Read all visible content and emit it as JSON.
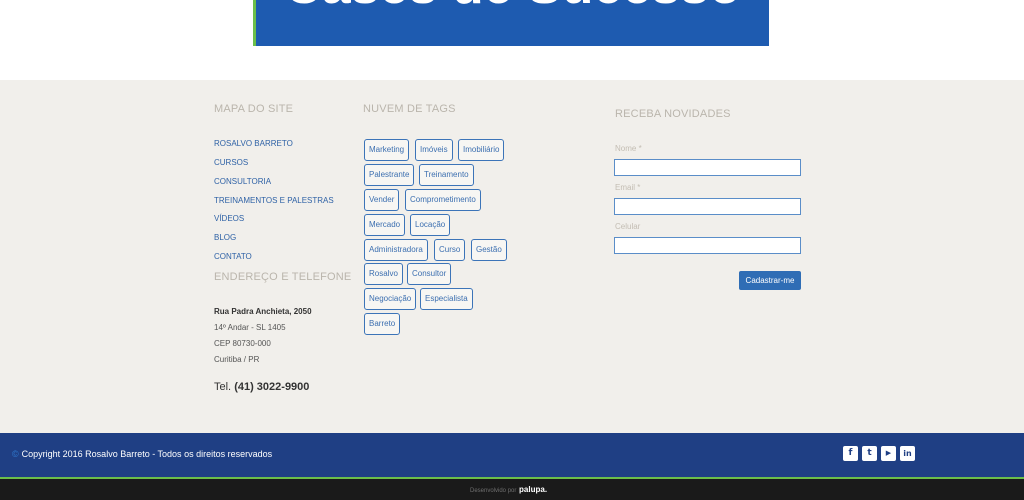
{
  "hero": {
    "text": "Cases de Sucesso"
  },
  "sitemap": {
    "heading": "MAPA DO SITE",
    "links": [
      "ROSALVO BARRETO",
      "CURSOS",
      "CONSULTORIA",
      "TREINAMENTOS E PALESTRAS",
      "VÍDEOS",
      "BLOG",
      "CONTATO"
    ]
  },
  "address": {
    "heading": "ENDEREÇO E TELEFONE",
    "street": "Rua Padra Anchieta, 2050",
    "floor": "14º Andar - SL 1405",
    "cep": "CEP 80730-000",
    "city": "Curitiba / PR",
    "phone_label": "Tel.",
    "phone_number": "(41) 3022-9900"
  },
  "tags": {
    "heading": "NUVEM DE TAGS",
    "items": [
      "Marketing",
      "Imóveis",
      "Imobiliário",
      "Palestrante",
      "Treinamento",
      "Vender",
      "Comprometimento",
      "Mercado",
      "Locação",
      "Administradora",
      "Curso",
      "Gestão",
      "Rosalvo",
      "Consultor",
      "Negociação",
      "Especialista",
      "Barreto"
    ]
  },
  "newsletter": {
    "heading": "RECEBA NOVIDADES",
    "name_label": "Nome *",
    "name_value": "",
    "email_label": "Email *",
    "email_value": "",
    "phone_label": "Celular",
    "phone_value": "",
    "submit_label": "Cadastrar-me"
  },
  "footer": {
    "copyright": "Copyright 2016 Rosalvo Barreto - Todos os direitos reservados",
    "social": [
      {
        "icon": "facebook-icon",
        "glyph": "f"
      },
      {
        "icon": "twitter-icon",
        "glyph": "t"
      },
      {
        "icon": "youtube-icon",
        "glyph": "▶"
      },
      {
        "icon": "linkedin-icon",
        "glyph": "in"
      }
    ],
    "developed_by": "Desenvolvido por",
    "developer": "palupa."
  },
  "colors": {
    "brand_blue": "#1f3f84",
    "accent_green": "#6bbf4a",
    "link_blue": "#2f62a6",
    "background": "#f1efeb"
  }
}
